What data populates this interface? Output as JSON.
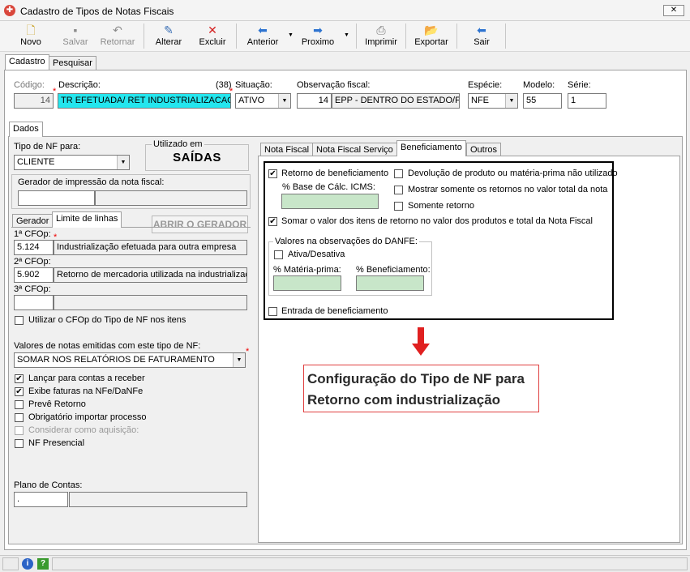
{
  "window": {
    "title": "Cadastro de Tipos de Notas Fiscais",
    "close": "✕"
  },
  "toolbar": {
    "novo": "Novo",
    "salvar": "Salvar",
    "retornar": "Retornar",
    "alterar": "Alterar",
    "excluir": "Excluir",
    "anterior": "Anterior",
    "proximo": "Proximo",
    "imprimir": "Imprimir",
    "exportar": "Exportar",
    "sair": "Sair"
  },
  "tabs": {
    "cadastro": "Cadastro",
    "pesquisar": "Pesquisar",
    "dados": "Dados"
  },
  "header": {
    "codigo_label": "Código:",
    "codigo_value": "14",
    "descricao_label": "Descrição:",
    "descricao_count": "(38)",
    "descricao_value": "TR EFETUADA/ RET INDUSTRIALIZACAO",
    "situacao_label": "Situação:",
    "situacao_value": "ATIVO",
    "obs_label": "Observação fiscal:",
    "obs_code": "14",
    "obs_value": "EPP - DENTRO DO ESTADO/F",
    "especie_label": "Espécie:",
    "especie_value": "NFE",
    "modelo_label": "Modelo:",
    "modelo_value": "55",
    "serie_label": "Série:",
    "serie_value": "1"
  },
  "left": {
    "tipo_label": "Tipo de NF para:",
    "tipo_value": "CLIENTE",
    "utilizado_label": "Utilizado em",
    "utilizado_value": "SAÍDAS",
    "gerador_label": "Gerador de impressão da nota fiscal:",
    "tab_gerador": "Gerador",
    "tab_limite": "Limite de linhas",
    "abrir_btn": "ABRIR O GERADOR",
    "cfop1_label": "1ª CFOp:",
    "cfop1_code": "5.124",
    "cfop1_desc": "Industrialização efetuada para outra empresa",
    "cfop2_label": "2ª CFOp:",
    "cfop2_code": "5.902",
    "cfop2_desc": "Retorno de mercadoria utilizada na industrializaçã",
    "cfop3_label": "3ª CFOp:",
    "utilizar_cfop": "Utilizar o CFOp do Tipo de NF nos itens",
    "valores_label": "Valores de notas emitidas com este tipo de NF:",
    "valores_value": "SOMAR NOS RELATÓRIOS DE FATURAMENTO",
    "checks": [
      {
        "label": "Lançar para contas a receber",
        "checked": true,
        "disabled": false
      },
      {
        "label": "Exibe faturas na NFe/DaNFe",
        "checked": true,
        "disabled": false
      },
      {
        "label": "Prevê Retorno",
        "checked": false,
        "disabled": false
      },
      {
        "label": "Obrigatório importar processo",
        "checked": false,
        "disabled": false
      },
      {
        "label": "Considerar como aquisição:",
        "checked": false,
        "disabled": true
      },
      {
        "label": "NF Presencial",
        "checked": false,
        "disabled": false
      }
    ],
    "plano_label": "Plano de Contas:",
    "plano_value": "."
  },
  "right": {
    "tabs": [
      "Nota Fiscal",
      "Nota Fiscal Serviço",
      "Beneficiamento",
      "Outros"
    ],
    "retorno_benef": "Retorno de beneficiamento",
    "base_calc": "% Base de Cálc. ICMS:",
    "devolucao": "Devolução de produto ou matéria-prima não utilizado",
    "mostrar": "Mostrar somente os retornos no valor total da nota",
    "somente": "Somente retorno",
    "somar": "Somar o valor dos itens de retorno no valor dos produtos e total da Nota Fiscal",
    "valores_obs": "Valores na observações do DANFE:",
    "ativa": "Ativa/Desativa",
    "materia": "% Matéria-prima:",
    "benef": "% Beneficiamento:",
    "entrada": "Entrada de beneficiamento"
  },
  "annotation": {
    "line1": "Configuração do Tipo de NF para",
    "line2": "Retorno com industrialização",
    "arrow_color": "#e02020",
    "box_color": "#e04040"
  },
  "status": {
    "info": "i",
    "help": "?"
  }
}
